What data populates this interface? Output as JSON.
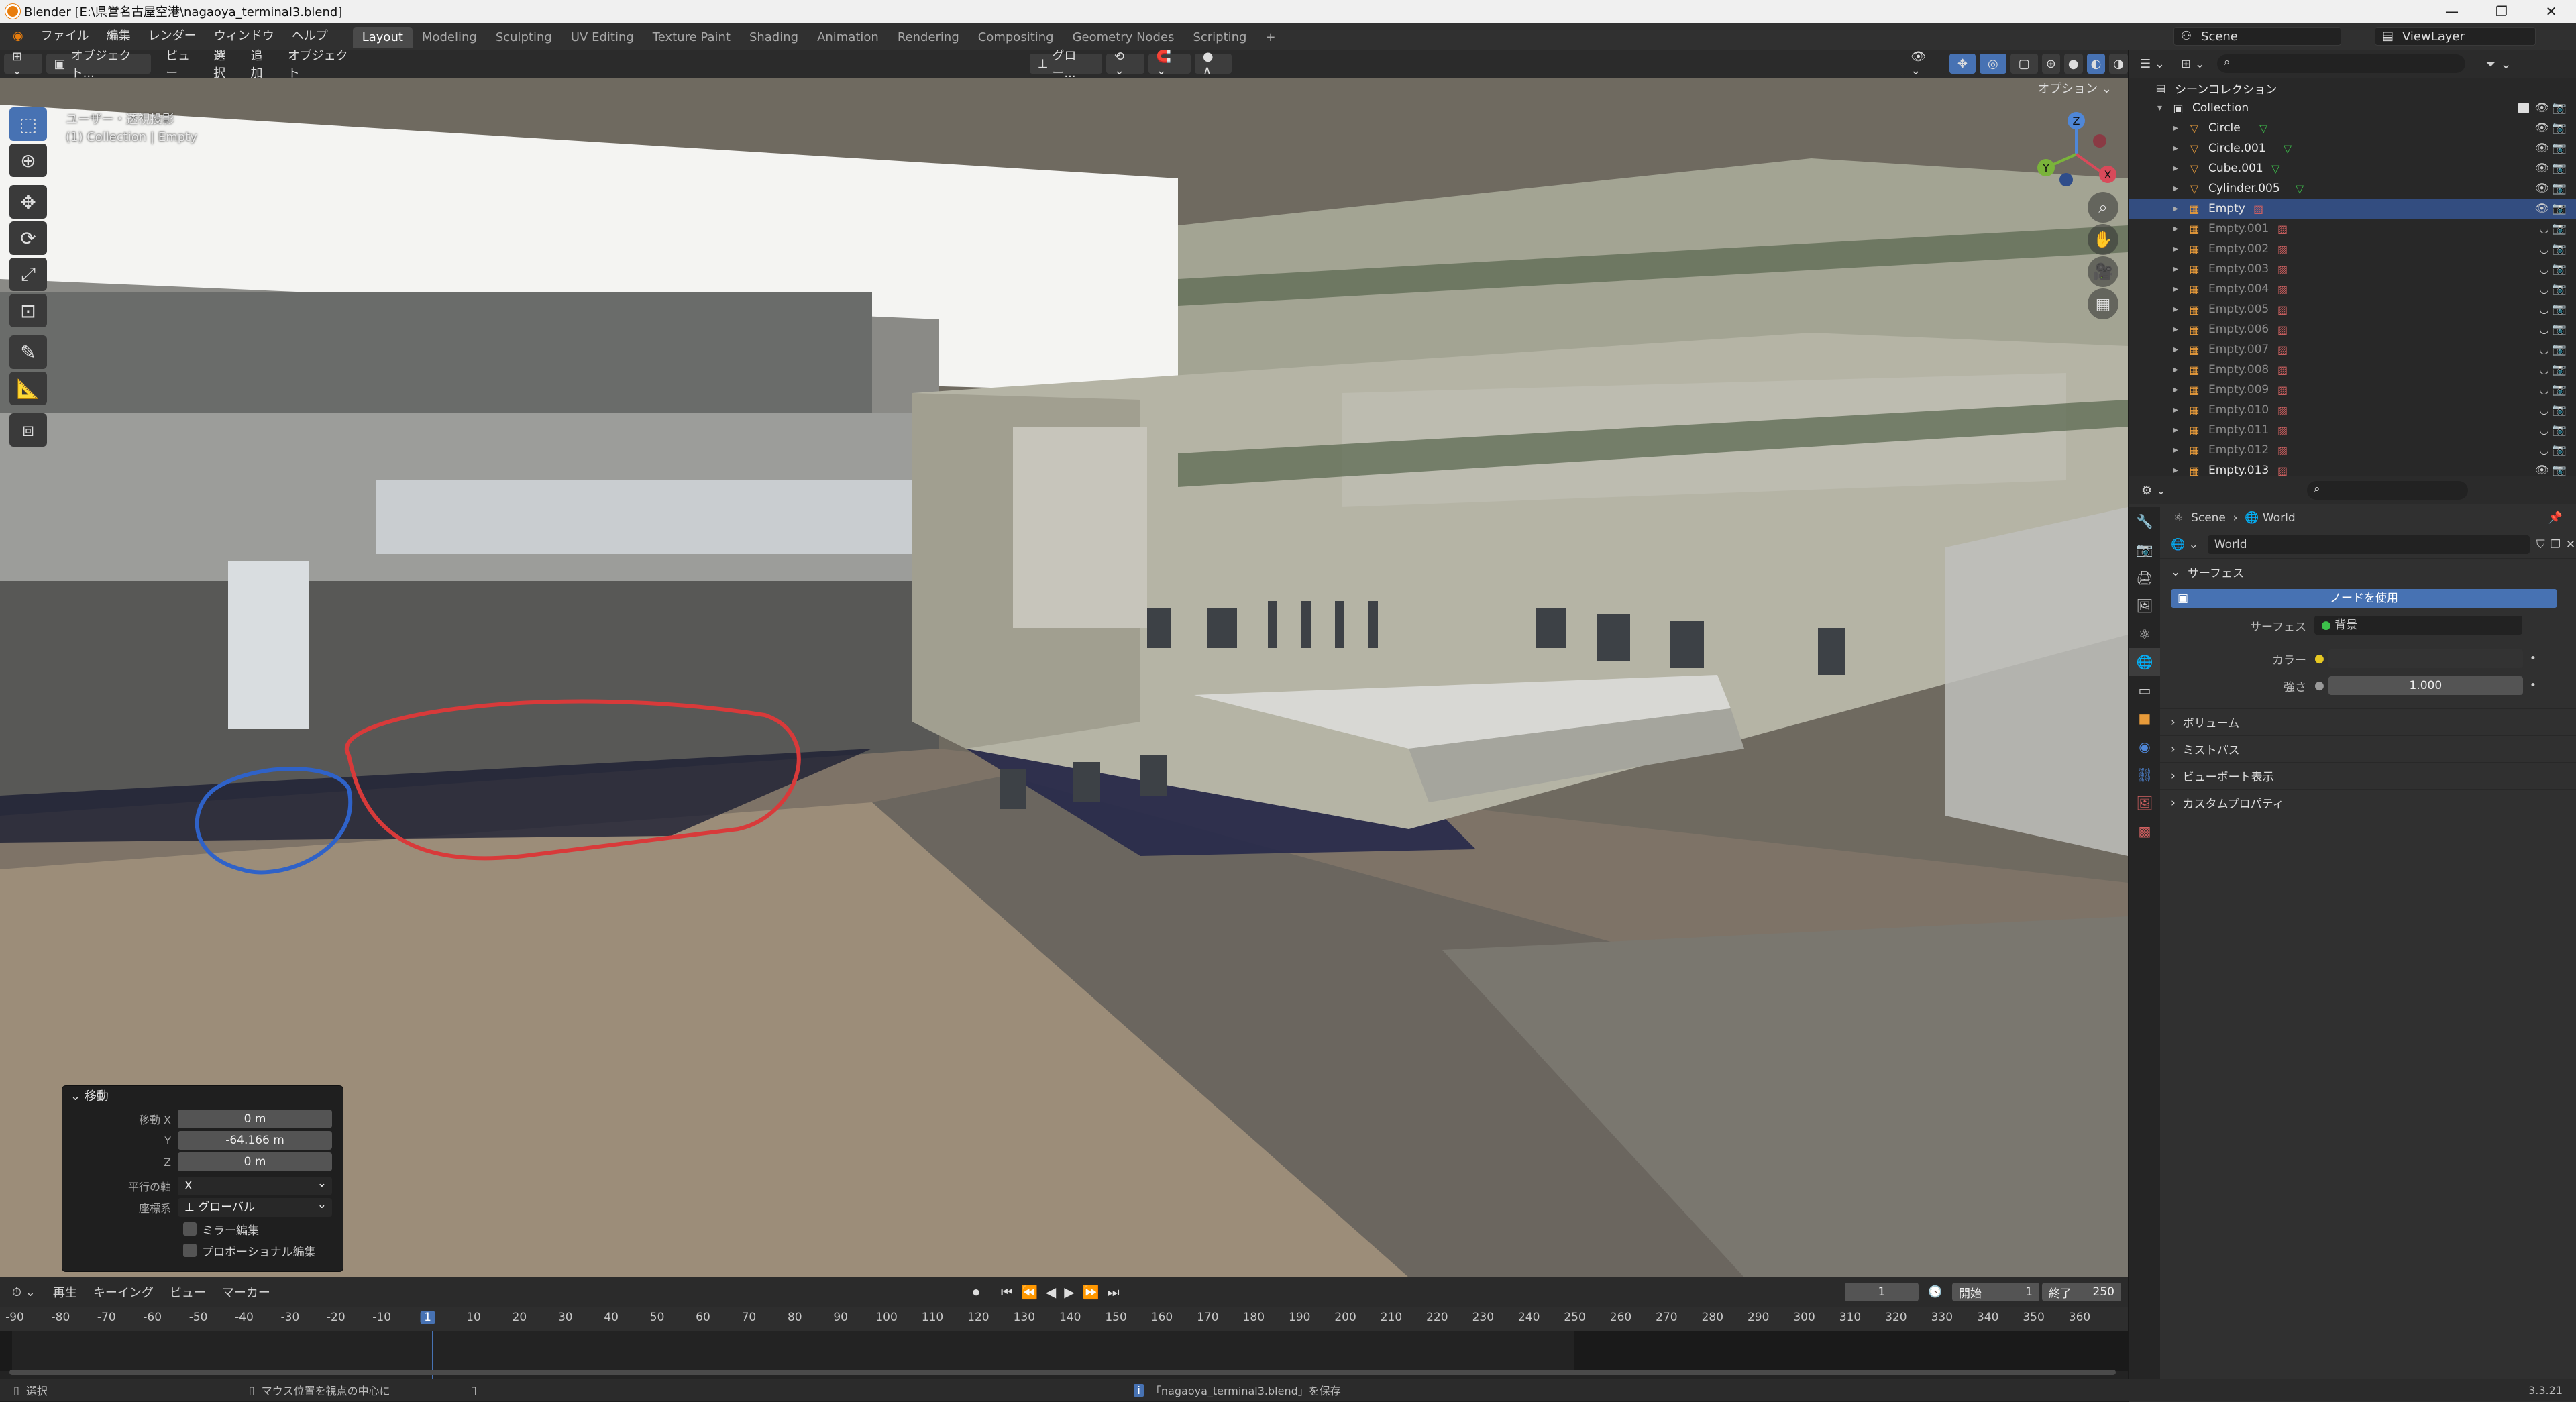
{
  "window": {
    "title": "Blender [E:\\県営名古屋空港\\nagaoya_terminal3.blend]"
  },
  "menu": [
    "ファイル",
    "編集",
    "レンダー",
    "ウィンドウ",
    "ヘルプ"
  ],
  "workspaces": [
    "Layout",
    "Modeling",
    "Sculpting",
    "UV Editing",
    "Texture Paint",
    "Shading",
    "Animation",
    "Rendering",
    "Compositing",
    "Geometry Nodes",
    "Scripting",
    "+"
  ],
  "scene": {
    "name": "Scene",
    "viewlayer": "ViewLayer"
  },
  "viewport_header": {
    "mode": "オブジェクト...",
    "menus": [
      "ビュー",
      "選択",
      "追加",
      "オブジェクト"
    ],
    "transform": "グロー...",
    "options": "オプション"
  },
  "viewport_info": {
    "line1": "ユーザー・透視投影",
    "line2": "(1) Collection | Empty"
  },
  "gizmo": {
    "z": "Z",
    "y": "Y",
    "x": "X"
  },
  "operator_panel": {
    "title": "移動",
    "rows": [
      {
        "label": "移動 X",
        "value": "0 m"
      },
      {
        "label": "Y",
        "value": "-64.166 m"
      },
      {
        "label": "Z",
        "value": "0 m"
      }
    ],
    "axis_label": "平行の軸",
    "axis_value": "X",
    "orient_label": "座標系",
    "orient_value": "グローバル",
    "mirror": "ミラー編集",
    "proportional": "プロポーショナル編集"
  },
  "outliner": {
    "root": "シーンコレクション",
    "collection": "Collection",
    "items": [
      {
        "name": "Circle",
        "type": "mesh",
        "active": false,
        "dim": false
      },
      {
        "name": "Circle.001",
        "type": "mesh",
        "active": false,
        "dim": false
      },
      {
        "name": "Cube.001",
        "type": "mesh",
        "active": false,
        "dim": false
      },
      {
        "name": "Cylinder.005",
        "type": "mesh",
        "active": false,
        "dim": false
      },
      {
        "name": "Empty",
        "type": "image",
        "active": true,
        "dim": false
      },
      {
        "name": "Empty.001",
        "type": "image",
        "active": false,
        "dim": true
      },
      {
        "name": "Empty.002",
        "type": "image",
        "active": false,
        "dim": true
      },
      {
        "name": "Empty.003",
        "type": "image",
        "active": false,
        "dim": true
      },
      {
        "name": "Empty.004",
        "type": "image",
        "active": false,
        "dim": true
      },
      {
        "name": "Empty.005",
        "type": "image",
        "active": false,
        "dim": true
      },
      {
        "name": "Empty.006",
        "type": "image",
        "active": false,
        "dim": true
      },
      {
        "name": "Empty.007",
        "type": "image",
        "active": false,
        "dim": true
      },
      {
        "name": "Empty.008",
        "type": "image",
        "active": false,
        "dim": true
      },
      {
        "name": "Empty.009",
        "type": "image",
        "active": false,
        "dim": true
      },
      {
        "name": "Empty.010",
        "type": "image",
        "active": false,
        "dim": true
      },
      {
        "name": "Empty.011",
        "type": "image",
        "active": false,
        "dim": true
      },
      {
        "name": "Empty.012",
        "type": "image",
        "active": false,
        "dim": true
      },
      {
        "name": "Empty.013",
        "type": "image",
        "active": false,
        "dim": false
      }
    ]
  },
  "properties": {
    "breadcrumb_scene": "Scene",
    "breadcrumb_world": "World",
    "world_name": "World",
    "surface_section": "サーフェス",
    "use_nodes": "ノードを使用",
    "surface_label": "サーフェス",
    "surface_value": "背景",
    "color_label": "カラー",
    "strength_label": "強さ",
    "strength_value": "1.000",
    "sections": [
      "ボリューム",
      "ミストパス",
      "ビューポート表示",
      "カスタムプロパティ"
    ]
  },
  "timeline": {
    "menus": [
      "再生",
      "キーイング",
      "ビュー",
      "マーカー"
    ],
    "current_frame": "1",
    "start_label": "開始",
    "start": "1",
    "end_label": "終了",
    "end": "250",
    "ticks": [
      "-90",
      "-80",
      "-70",
      "-60",
      "-50",
      "-40",
      "-30",
      "-20",
      "-10",
      "1",
      "10",
      "20",
      "30",
      "40",
      "50",
      "60",
      "70",
      "80",
      "90",
      "100",
      "110",
      "120",
      "130",
      "140",
      "150",
      "160",
      "170",
      "180",
      "190",
      "200",
      "210",
      "220",
      "230",
      "240",
      "250",
      "260",
      "270",
      "280",
      "290",
      "300",
      "310",
      "320",
      "330",
      "340",
      "350",
      "360"
    ]
  },
  "statusbar": {
    "select": "選択",
    "center": "マウス位置を視点の中心に",
    "saved": "「nagaoya_terminal3.blend」を保存",
    "version": "3.3.21"
  }
}
